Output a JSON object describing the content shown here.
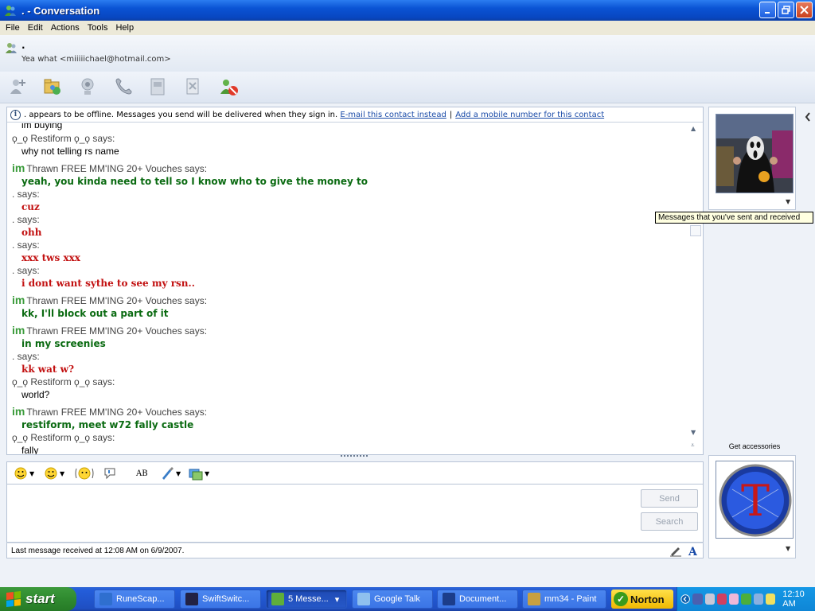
{
  "window": {
    "title": ". - Conversation"
  },
  "menu": {
    "items": [
      "File",
      "Edit",
      "Actions",
      "Tools",
      "Help"
    ]
  },
  "contact": {
    "name": ".",
    "status": "Yea what <miiiiichael@hotmail.com>"
  },
  "info_bar": {
    "text": ". appears to be offline. Messages you send will be delivered when they sign in.",
    "link_email": "E-mail this contact instead",
    "separator": "|",
    "link_mobile": "Add a mobile number for this contact"
  },
  "messages": [
    {
      "kind": "text-plain",
      "text": "im buying"
    },
    {
      "kind": "says",
      "text": "ϙ_ϙ Restiform ϙ_ϙ says:"
    },
    {
      "kind": "text-plain",
      "text": "why not telling rs name"
    },
    {
      "kind": "says-im",
      "text": "Thrawn FREE MM'ING 20+ Vouches says:"
    },
    {
      "kind": "text-green",
      "text": "yeah, you kinda need to tell so I know who to give the money to"
    },
    {
      "kind": "says",
      "text": ". says:"
    },
    {
      "kind": "text-red",
      "text": "cuz"
    },
    {
      "kind": "says",
      "text": ". says:"
    },
    {
      "kind": "text-red",
      "text": "ohh"
    },
    {
      "kind": "says",
      "text": ". says:"
    },
    {
      "kind": "text-red",
      "text": "xxx tws xxx"
    },
    {
      "kind": "says",
      "text": ". says:"
    },
    {
      "kind": "text-red",
      "text": "i dont want sythe to see my rsn.."
    },
    {
      "kind": "says-im",
      "text": "Thrawn FREE MM'ING 20+ Vouches says:"
    },
    {
      "kind": "text-green",
      "text": "kk, I'll block out a part of it"
    },
    {
      "kind": "says-im",
      "text": "Thrawn FREE MM'ING 20+ Vouches says:"
    },
    {
      "kind": "text-green",
      "text": "in my screenies"
    },
    {
      "kind": "says",
      "text": ". says:"
    },
    {
      "kind": "text-red",
      "text": "kk wat w?"
    },
    {
      "kind": "says",
      "text": "ϙ_ϙ Restiform ϙ_ϙ says:"
    },
    {
      "kind": "text-plain",
      "text": "world?"
    },
    {
      "kind": "says-im",
      "text": "Thrawn FREE MM'ING 20+ Vouches says:"
    },
    {
      "kind": "text-green",
      "text": "restiform, meet w72 fally castle"
    },
    {
      "kind": "says",
      "text": "ϙ_ϙ Restiform ϙ_ϙ says:"
    },
    {
      "kind": "text-plain",
      "text": "fally"
    }
  ],
  "im_badge": "im",
  "compose": {
    "send_label": "Send",
    "search_label": "Search",
    "status": "Last message received at 12:08 AM on 6/9/2007."
  },
  "compose_toolbar": {
    "spell_label": "AB"
  },
  "right_panel": {
    "accessories_label": "Get accessories",
    "display_letter": "T"
  },
  "tooltip": "Messages that you've sent and received",
  "taskbar": {
    "start_label": "start",
    "tasks": [
      {
        "label": "RuneScap...",
        "color": "#2f6fcf"
      },
      {
        "label": "SwiftSwitc...",
        "color": "#222244"
      },
      {
        "label": "5 Messe...",
        "color": "#5fae3a"
      },
      {
        "label": "Google Talk",
        "color": "#8fc0ee"
      },
      {
        "label": "Document...",
        "color": "#1c3d8a"
      },
      {
        "label": "mm34 - Paint",
        "color": "#c8a040"
      }
    ],
    "norton_label": "Norton",
    "clock": "12:10 AM"
  }
}
